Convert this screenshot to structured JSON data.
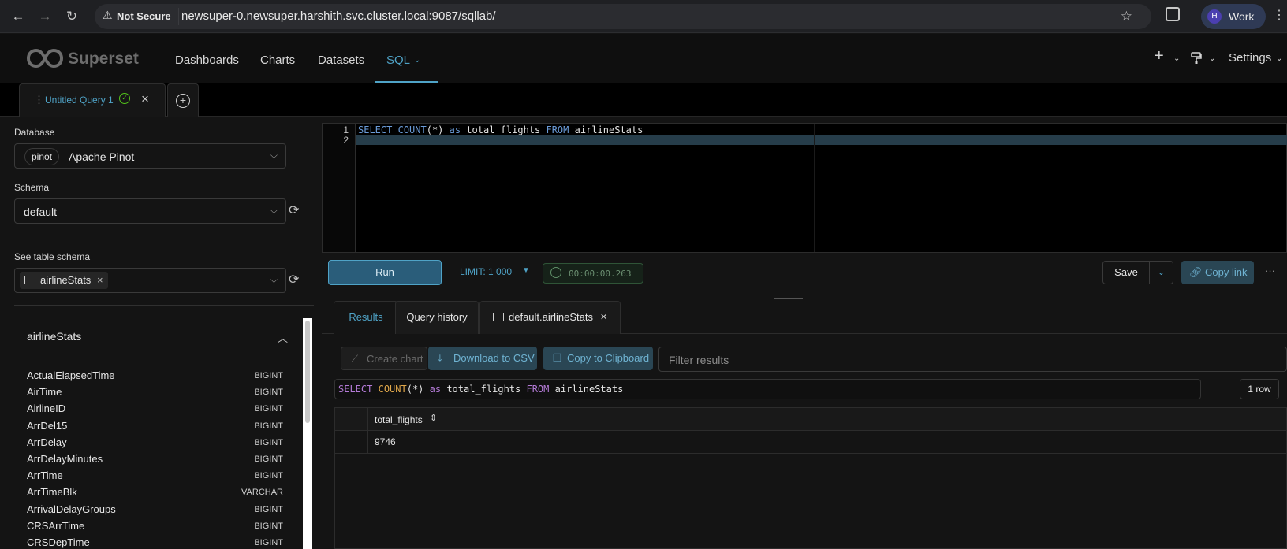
{
  "browser": {
    "security_label": "Not Secure",
    "url": "newsuper-0.newsuper.harshith.svc.cluster.local:9087/sqllab/",
    "profile_initial": "H",
    "profile_label": "Work"
  },
  "header": {
    "brand": "Superset",
    "menu": [
      "Dashboards",
      "Charts",
      "Datasets",
      "SQL"
    ],
    "settings_label": "Settings"
  },
  "query_tab": {
    "label": "Untitled Query 1"
  },
  "left": {
    "database_label": "Database",
    "database_pill": "pinot",
    "database_value": "Apache Pinot",
    "schema_label": "Schema",
    "schema_value": "default",
    "table_label": "See table schema",
    "table_tag": "airlineStats",
    "card_title": "airlineStats",
    "columns": [
      {
        "name": "ActualElapsedTime",
        "type": "BIGINT"
      },
      {
        "name": "AirTime",
        "type": "BIGINT"
      },
      {
        "name": "AirlineID",
        "type": "BIGINT"
      },
      {
        "name": "ArrDel15",
        "type": "BIGINT"
      },
      {
        "name": "ArrDelay",
        "type": "BIGINT"
      },
      {
        "name": "ArrDelayMinutes",
        "type": "BIGINT"
      },
      {
        "name": "ArrTime",
        "type": "BIGINT"
      },
      {
        "name": "ArrTimeBlk",
        "type": "VARCHAR"
      },
      {
        "name": "ArrivalDelayGroups",
        "type": "BIGINT"
      },
      {
        "name": "CRSArrTime",
        "type": "BIGINT"
      },
      {
        "name": "CRSDepTime",
        "type": "BIGINT"
      }
    ]
  },
  "editor": {
    "line_numbers": [
      "1",
      "2"
    ],
    "sql": {
      "kw_select": "SELECT",
      "fn_count": "COUNT",
      "arg": "(*)",
      "kw_as": "as",
      "alias": "total_flights",
      "kw_from": "FROM",
      "table": "airlineStats"
    }
  },
  "toolbar": {
    "run_label": "Run",
    "limit_label": "LIMIT: 1 000",
    "timer": "00:00:00.263",
    "save_label": "Save",
    "copy_link_label": "Copy link"
  },
  "results": {
    "tabs": [
      "Results",
      "Query history",
      "default.airlineStats"
    ],
    "create_chart_label": "Create chart",
    "download_csv_label": "Download to CSV",
    "copy_clipboard_label": "Copy to Clipboard",
    "filter_placeholder": "Filter results",
    "row_count": "1 row",
    "column_header": "total_flights",
    "cell_value": "9746"
  }
}
